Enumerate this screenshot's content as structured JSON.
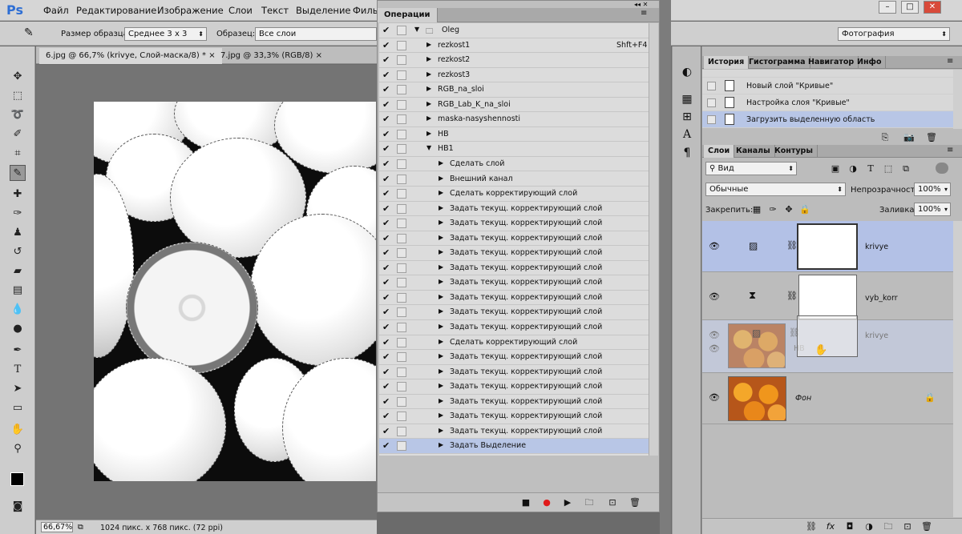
{
  "app": {
    "logo": "Ps"
  },
  "menu": [
    "Файл",
    "Редактирование",
    "Изображение",
    "Слои",
    "Текст",
    "Выделение",
    "Филь"
  ],
  "window_buttons": [
    "–",
    "□",
    "✕"
  ],
  "options_bar": {
    "sample_size_label": "Размер образца:",
    "sample_size_value": "Среднее 3 х 3",
    "sample_label": "Образец:",
    "sample_value": "Все слои",
    "workspace": "Фотография"
  },
  "doc_tabs": [
    "6.jpg @ 66,7% (krivye, Слой-маска/8) *",
    "7.jpg @ 33,3% (RGB/8)"
  ],
  "status": {
    "zoom": "66,67%",
    "info": "1024 пикс. x 768 пикс. (72 ppi)"
  },
  "actions_panel": {
    "title": "Операции",
    "rows": [
      {
        "indent": 0,
        "expanded": true,
        "folder": true,
        "label": "Oleg",
        "key": ""
      },
      {
        "indent": 1,
        "expanded": false,
        "label": "rezkost1",
        "key": "Shft+F4"
      },
      {
        "indent": 1,
        "expanded": false,
        "label": "rezkost2",
        "key": ""
      },
      {
        "indent": 1,
        "expanded": false,
        "label": "rezkost3",
        "key": ""
      },
      {
        "indent": 1,
        "expanded": false,
        "label": "RGB_na_sloi",
        "key": ""
      },
      {
        "indent": 1,
        "expanded": false,
        "label": "RGB_Lab_K_na_sloi",
        "key": ""
      },
      {
        "indent": 1,
        "expanded": false,
        "label": "maska-nasyshennosti",
        "key": ""
      },
      {
        "indent": 1,
        "expanded": false,
        "label": "HB",
        "key": ""
      },
      {
        "indent": 1,
        "expanded": true,
        "label": "HB1",
        "key": ""
      },
      {
        "indent": 2,
        "expanded": false,
        "label": "Сделать слой",
        "key": ""
      },
      {
        "indent": 2,
        "expanded": false,
        "label": "Внешний канал",
        "key": ""
      },
      {
        "indent": 2,
        "expanded": false,
        "label": "Сделать корректирующий слой",
        "key": ""
      },
      {
        "indent": 2,
        "expanded": false,
        "label": "Задать текущ. корректирующий слой",
        "key": ""
      },
      {
        "indent": 2,
        "expanded": false,
        "label": "Задать текущ. корректирующий слой",
        "key": ""
      },
      {
        "indent": 2,
        "expanded": false,
        "label": "Задать текущ. корректирующий слой",
        "key": ""
      },
      {
        "indent": 2,
        "expanded": false,
        "label": "Задать текущ. корректирующий слой",
        "key": ""
      },
      {
        "indent": 2,
        "expanded": false,
        "label": "Задать текущ. корректирующий слой",
        "key": ""
      },
      {
        "indent": 2,
        "expanded": false,
        "label": "Задать текущ. корректирующий слой",
        "key": ""
      },
      {
        "indent": 2,
        "expanded": false,
        "label": "Задать текущ. корректирующий слой",
        "key": ""
      },
      {
        "indent": 2,
        "expanded": false,
        "label": "Задать текущ. корректирующий слой",
        "key": ""
      },
      {
        "indent": 2,
        "expanded": false,
        "label": "Задать текущ. корректирующий слой",
        "key": ""
      },
      {
        "indent": 2,
        "expanded": false,
        "label": "Сделать корректирующий слой",
        "key": ""
      },
      {
        "indent": 2,
        "expanded": false,
        "label": "Задать текущ. корректирующий слой",
        "key": ""
      },
      {
        "indent": 2,
        "expanded": false,
        "label": "Задать текущ. корректирующий слой",
        "key": ""
      },
      {
        "indent": 2,
        "expanded": false,
        "label": "Задать текущ. корректирующий слой",
        "key": ""
      },
      {
        "indent": 2,
        "expanded": false,
        "label": "Задать текущ. корректирующий слой",
        "key": ""
      },
      {
        "indent": 2,
        "expanded": false,
        "label": "Задать текущ. корректирующий слой",
        "key": ""
      },
      {
        "indent": 2,
        "expanded": false,
        "label": "Задать текущ. корректирующий слой",
        "key": ""
      },
      {
        "indent": 2,
        "expanded": false,
        "label": "Задать Выделение",
        "key": "",
        "selected": true
      }
    ]
  },
  "history_tabs": [
    "История",
    "Гистограмма",
    "Навигатор",
    "Инфо"
  ],
  "history_rows": [
    {
      "label": "Новый слой \"Кривые\"",
      "selected": false
    },
    {
      "label": "Настройка слоя \"Кривые\"",
      "selected": false
    },
    {
      "label": "Загрузить выделенную область",
      "selected": true
    }
  ],
  "layers_tabs": [
    "Слои",
    "Каналы",
    "Контуры"
  ],
  "layers": {
    "filter": "Вид",
    "blend_mode": "Обычные",
    "opacity_label": "Непрозрачность:",
    "opacity": "100%",
    "lock_label": "Закрепить:",
    "fill_label": "Заливка:",
    "fill": "100%",
    "items": [
      {
        "name": "krivye",
        "kind": "curves"
      },
      {
        "name": "vyb_korr",
        "kind": "selective"
      },
      {
        "name": "krivye",
        "kind": "curves-drag",
        "mask_label": "HB"
      },
      {
        "name": "Фон",
        "kind": "background"
      }
    ]
  }
}
